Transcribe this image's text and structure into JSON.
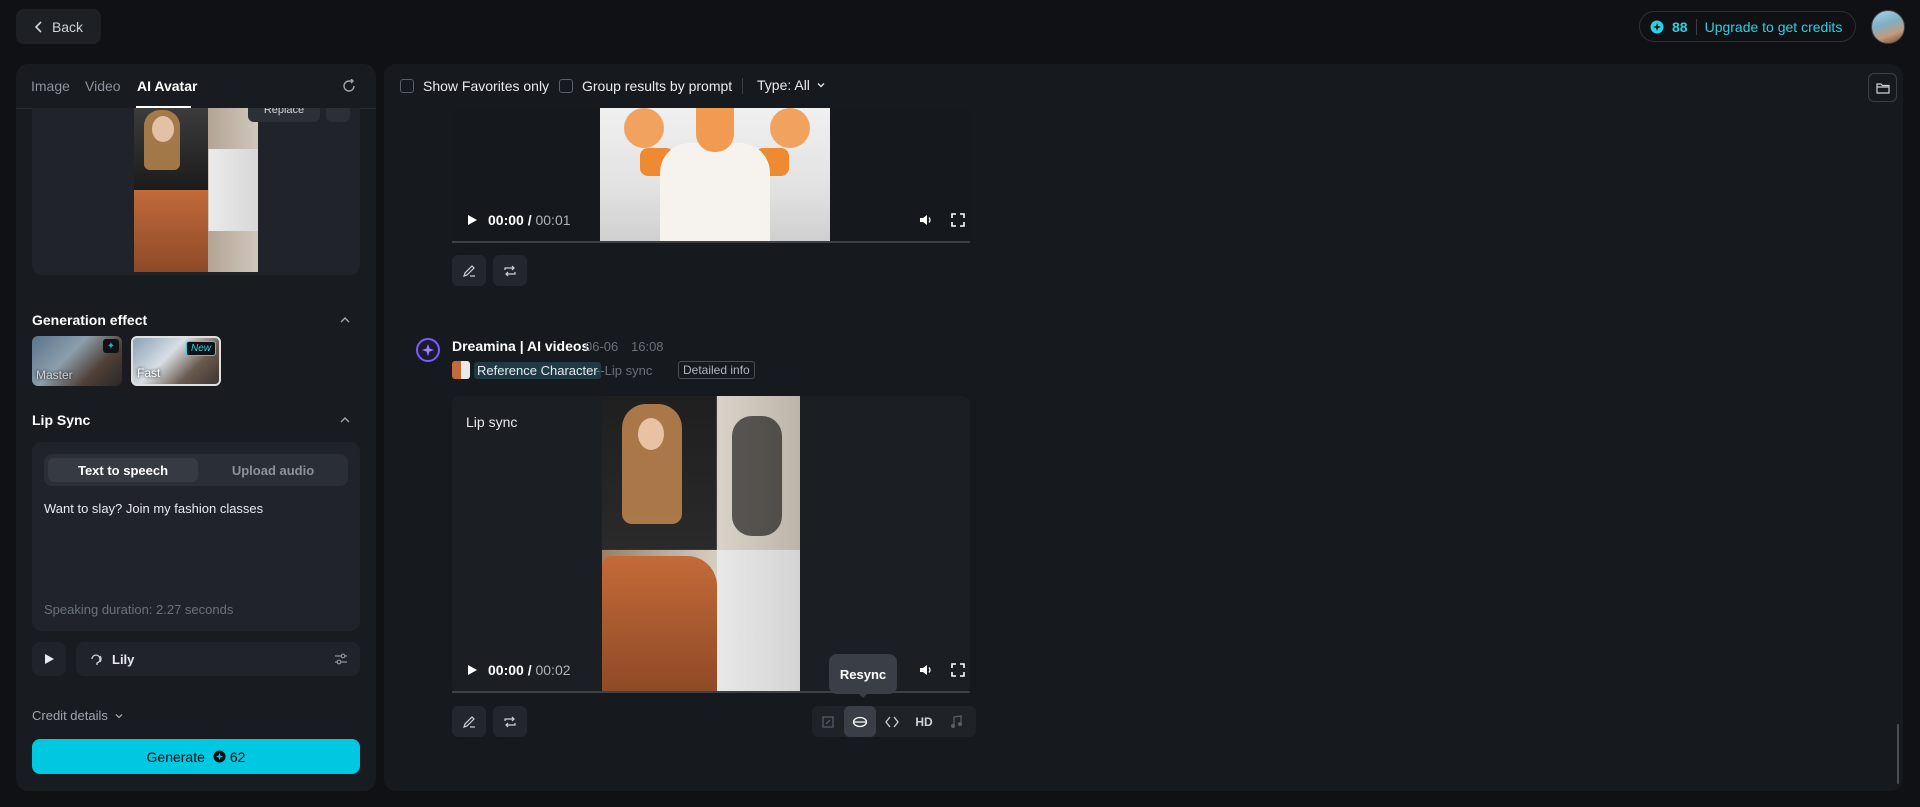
{
  "topbar": {
    "back_label": "Back",
    "credits_count": "88",
    "upgrade_label": "Upgrade to get credits"
  },
  "left": {
    "tabs": [
      {
        "label": "Image"
      },
      {
        "label": "Video"
      },
      {
        "label": "AI Avatar",
        "active": true
      }
    ],
    "replace_label": "Replace",
    "generation_effect": {
      "title": "Generation effect",
      "options": [
        {
          "label": "Master",
          "badge": "✦"
        },
        {
          "label": "Fast",
          "badge": "New",
          "selected": true
        }
      ]
    },
    "lip_sync": {
      "title": "Lip Sync",
      "tts_label": "Text to speech",
      "upload_label": "Upload audio",
      "text": "Want to slay? Join my fashion classes",
      "duration": "Speaking duration: 2.27 seconds"
    },
    "voice": {
      "name": "Lily"
    },
    "credit_details_label": "Credit details",
    "generate": {
      "label": "Generate",
      "cost": "62"
    }
  },
  "main": {
    "toolbar": {
      "favorites_label": "Show Favorites only",
      "group_label": "Group results by prompt",
      "type_label": "Type: All"
    },
    "video1": {
      "current": "00:00",
      "sep": "/",
      "total": "00:01"
    },
    "generation": {
      "author": "Dreamina | AI videos",
      "date": "06-06",
      "time": "16:08",
      "ref_tag": "Reference Character",
      "mode": "--Lip sync",
      "detailed_info": "Detailed info"
    },
    "video2": {
      "label": "Lip sync",
      "current": "00:00",
      "sep": "/",
      "total": "00:02"
    },
    "tooltip": "Resync",
    "hd_label": "HD"
  },
  "colors": {
    "accent": "#00c8e0",
    "background": "#0f1114",
    "panel": "#181b20"
  },
  "icons": [
    "chevron-left-icon",
    "credit-coin-icon",
    "refresh-icon",
    "chevron-up-icon",
    "play-icon",
    "voice-icon",
    "settings-sliders-icon",
    "chevron-down-icon",
    "folder-icon",
    "volume-icon",
    "fullscreen-icon",
    "edit-icon",
    "repeat-icon",
    "crop-icon",
    "lips-icon",
    "expand-icon",
    "music-icon"
  ]
}
